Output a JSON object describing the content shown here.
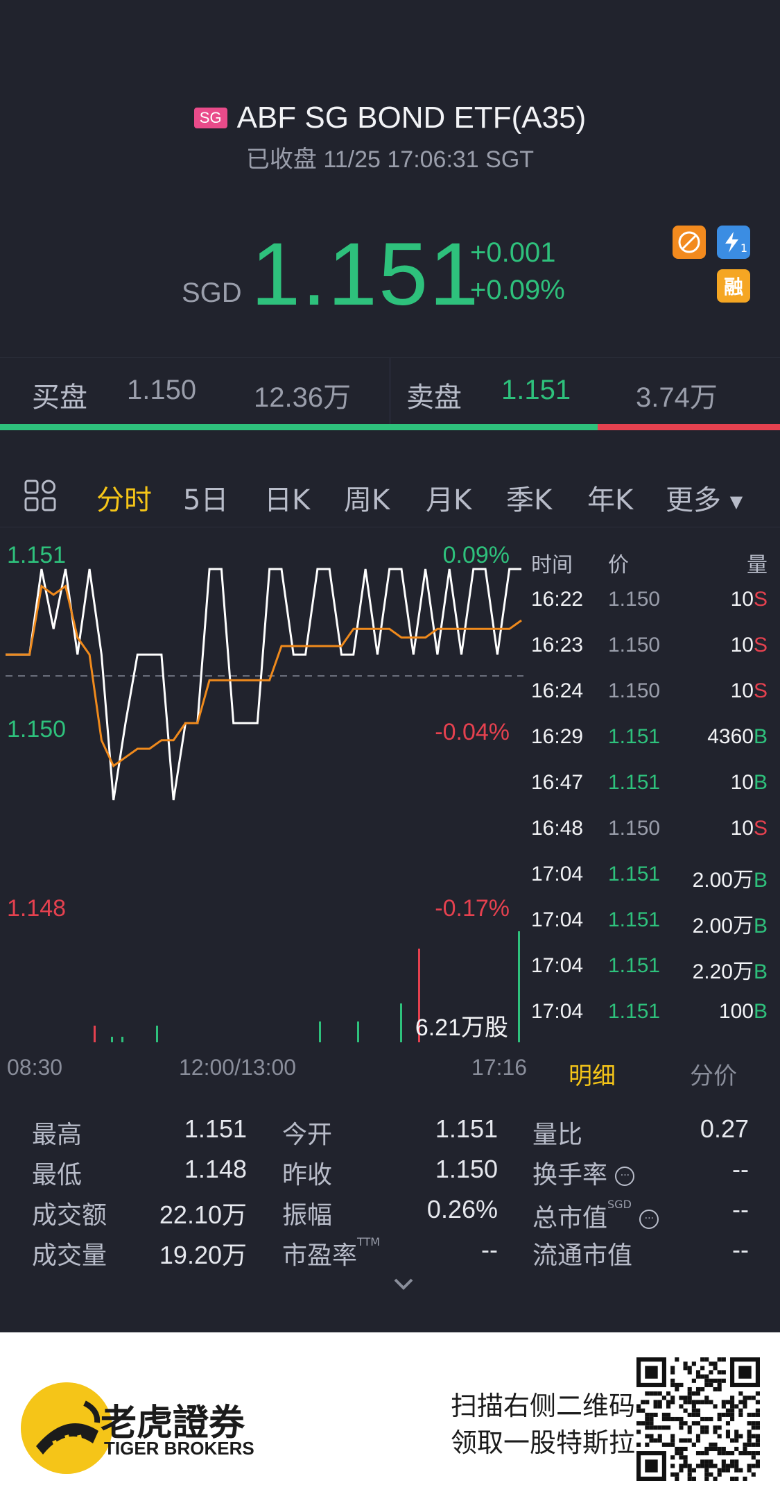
{
  "header": {
    "market_badge": "SG",
    "title": "ABF SG BOND ETF(A35)",
    "status": "已收盘 11/25 17:06:31 SGT",
    "currency": "SGD",
    "price": "1.151",
    "change": "+0.001",
    "change_pct": "+0.09%",
    "badge_b_text": "1",
    "badge_c_text": "融"
  },
  "bidask": {
    "bid_label": "买盘",
    "bid_price": "1.150",
    "bid_volume": "12.36万",
    "ask_label": "卖盘",
    "ask_price": "1.151",
    "ask_volume": "3.74万",
    "bid_ratio": 0.766
  },
  "tabs": [
    "分时",
    "5日",
    "日K",
    "周K",
    "月K",
    "季K",
    "年K",
    "更多"
  ],
  "active_tab": "分时",
  "chart_data": {
    "type": "line",
    "y_left_ticks": [
      "1.151",
      "1.150",
      "1.148"
    ],
    "y_right_ticks": [
      "0.09%",
      "-0.04%",
      "-0.17%"
    ],
    "x_ticks": [
      "08:30",
      "12:00/13:00",
      "17:16"
    ],
    "prev_close": 1.15,
    "ylim": [
      1.148,
      1.151
    ],
    "volume_label": "6.21万股",
    "series": [
      {
        "values": [
          1.15,
          1.15,
          1.15,
          1.151,
          1.1503,
          1.151,
          1.15,
          1.151,
          1.15,
          1.1483,
          1.1492,
          1.15,
          1.15,
          1.15,
          1.1483,
          1.1492,
          1.1492,
          1.151,
          1.151,
          1.1492,
          1.1492,
          1.1492,
          1.151,
          1.151,
          1.15,
          1.15,
          1.151,
          1.151,
          1.15,
          1.15,
          1.151,
          1.15,
          1.151,
          1.151,
          1.15,
          1.151,
          1.15,
          1.151,
          1.15,
          1.151,
          1.151,
          1.15,
          1.151,
          1.151
        ]
      },
      {
        "values": [
          1.15,
          1.15,
          1.15,
          1.1508,
          1.1507,
          1.1508,
          1.1502,
          1.15,
          1.149,
          1.1487,
          1.1488,
          1.1489,
          1.1489,
          1.149,
          1.149,
          1.1492,
          1.1492,
          1.1497,
          1.1497,
          1.1497,
          1.1497,
          1.1497,
          1.1497,
          1.1501,
          1.1501,
          1.1501,
          1.1501,
          1.1501,
          1.1501,
          1.1503,
          1.1503,
          1.1503,
          1.1503,
          1.1502,
          1.1502,
          1.1502,
          1.1503,
          1.1503,
          1.1503,
          1.1503,
          1.1503,
          1.1503,
          1.1503,
          1.1504
        ]
      }
    ]
  },
  "ticks": {
    "headers": [
      "时间",
      "价",
      "量"
    ],
    "rows": [
      {
        "time": "16:22",
        "price": "1.150",
        "vol": "10",
        "side": "S"
      },
      {
        "time": "16:23",
        "price": "1.150",
        "vol": "10",
        "side": "S"
      },
      {
        "time": "16:24",
        "price": "1.150",
        "vol": "10",
        "side": "S"
      },
      {
        "time": "16:29",
        "price": "1.151",
        "vol": "4360",
        "side": "B"
      },
      {
        "time": "16:47",
        "price": "1.151",
        "vol": "10",
        "side": "B"
      },
      {
        "time": "16:48",
        "price": "1.150",
        "vol": "10",
        "side": "S"
      },
      {
        "time": "17:04",
        "price": "1.151",
        "vol": "2.00万",
        "side": "B"
      },
      {
        "time": "17:04",
        "price": "1.151",
        "vol": "2.00万",
        "side": "B"
      },
      {
        "time": "17:04",
        "price": "1.151",
        "vol": "2.20万",
        "side": "B"
      },
      {
        "time": "17:04",
        "price": "1.151",
        "vol": "100",
        "side": "B"
      }
    ],
    "tab_detail": "明细",
    "tab_price": "分价"
  },
  "stats": {
    "high_label": "最高",
    "high": "1.151",
    "low_label": "最低",
    "low": "1.148",
    "turnover_label": "成交额",
    "turnover": "22.10万",
    "volume_label": "成交量",
    "volume": "19.20万",
    "open_label": "今开",
    "open": "1.151",
    "prev_close_label": "昨收",
    "prev_close": "1.150",
    "amplitude_label": "振幅",
    "amplitude": "0.26%",
    "pe_label": "市盈率",
    "pe_sup": "TTM",
    "pe": "--",
    "vol_ratio_label": "量比",
    "vol_ratio": "0.27",
    "turnover_rate_label": "换手率",
    "turnover_rate": "--",
    "market_cap_label": "总市值",
    "market_cap_sup": "SGD",
    "market_cap": "--",
    "float_cap_label": "流通市值",
    "float_cap": "--"
  },
  "footer": {
    "brand_cn": "老虎證券",
    "brand_en": "TIGER BROKERS",
    "promo_line1": "扫描右侧二维码",
    "promo_line2": "领取一股特斯拉"
  },
  "colors": {
    "up": "#2ec17c",
    "down": "#e5414f",
    "accent": "#f5c518",
    "bg": "#21232d"
  }
}
